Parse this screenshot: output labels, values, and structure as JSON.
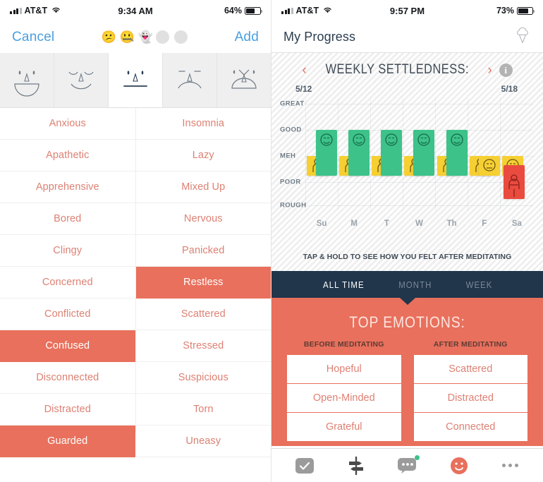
{
  "left": {
    "status": {
      "carrier": "AT&T",
      "time": "9:34 AM",
      "battery": "64%"
    },
    "nav": {
      "cancel": "Cancel",
      "add": "Add"
    },
    "progress_dots": [
      "😕",
      "🤐",
      "👻",
      "",
      ""
    ],
    "faces": [
      {
        "name": "big-smile",
        "selected": false
      },
      {
        "name": "closed-eye-smile",
        "selected": false
      },
      {
        "name": "neutral",
        "selected": true
      },
      {
        "name": "frown",
        "selected": false
      },
      {
        "name": "distressed",
        "selected": false
      }
    ],
    "emotions_left": [
      {
        "label": "Anxious",
        "selected": false
      },
      {
        "label": "Apathetic",
        "selected": false
      },
      {
        "label": "Apprehensive",
        "selected": false
      },
      {
        "label": "Bored",
        "selected": false
      },
      {
        "label": "Clingy",
        "selected": false
      },
      {
        "label": "Concerned",
        "selected": false
      },
      {
        "label": "Conflicted",
        "selected": false
      },
      {
        "label": "Confused",
        "selected": true
      },
      {
        "label": "Disconnected",
        "selected": false
      },
      {
        "label": "Distracted",
        "selected": false
      },
      {
        "label": "Guarded",
        "selected": true
      }
    ],
    "emotions_right": [
      {
        "label": "Insomnia",
        "selected": false
      },
      {
        "label": "Lazy",
        "selected": false
      },
      {
        "label": "Mixed Up",
        "selected": false
      },
      {
        "label": "Nervous",
        "selected": false
      },
      {
        "label": "Panicked",
        "selected": false
      },
      {
        "label": "Restless",
        "selected": true
      },
      {
        "label": "Scattered",
        "selected": false
      },
      {
        "label": "Stressed",
        "selected": false
      },
      {
        "label": "Suspicious",
        "selected": false
      },
      {
        "label": "Torn",
        "selected": false
      },
      {
        "label": "Uneasy",
        "selected": false
      }
    ]
  },
  "right": {
    "status": {
      "carrier": "AT&T",
      "time": "9:57 PM",
      "battery": "73%"
    },
    "nav": {
      "title": "My Progress",
      "action_icon": "ice-cream-cone-icon"
    },
    "chart_header": {
      "prev": "‹",
      "title": "WEEKLY SETTLEDNESS:",
      "next": "›",
      "info": "i"
    },
    "date_range": {
      "start": "5/12",
      "end": "5/18"
    },
    "hint": "TAP & HOLD TO SEE HOW YOU FELT AFTER MEDITATING",
    "tabs": [
      {
        "label": "ALL TIME",
        "active": true
      },
      {
        "label": "MONTH",
        "active": false
      },
      {
        "label": "WEEK",
        "active": false
      }
    ],
    "top_emotions": {
      "title": "TOP EMOTIONS:",
      "before_header": "BEFORE MEDITATING",
      "after_header": "AFTER MEDITATING",
      "before": [
        "Hopeful",
        "Open-Minded",
        "Grateful"
      ],
      "after": [
        "Scattered",
        "Distracted",
        "Connected"
      ]
    },
    "bottom_nav": [
      {
        "name": "checkmark-icon"
      },
      {
        "name": "signpost-icon"
      },
      {
        "name": "chat-bubble-icon",
        "badge": true
      },
      {
        "name": "smiley-face-icon",
        "active": true
      },
      {
        "name": "more-icon"
      }
    ]
  },
  "chart_data": {
    "type": "bar",
    "title": "WEEKLY SETTLEDNESS:",
    "xlabel": "",
    "ylabel": "",
    "categories": [
      "Su",
      "M",
      "T",
      "W",
      "Th",
      "F",
      "Sa"
    ],
    "ylevels": [
      "GREAT",
      "GOOD",
      "MEH",
      "POOR",
      "ROUGH"
    ],
    "ylim": [
      0,
      5
    ],
    "grid": true,
    "legend_position": "none",
    "date_start": "5/12",
    "date_end": "5/18",
    "series": [
      {
        "name": "Before Meditating",
        "values": [
          "MEH",
          "MEH",
          "MEH",
          "MEH",
          "MEH",
          "MEH",
          "MEH"
        ],
        "numeric": [
          3,
          3,
          3,
          3,
          3,
          3,
          3
        ],
        "color": "#f6cf33"
      },
      {
        "name": "After Meditating",
        "values": [
          "GOOD",
          "GOOD",
          "GOOD",
          "GOOD",
          "GOOD",
          "MEH",
          "POOR"
        ],
        "numeric": [
          4,
          4,
          4,
          4,
          4,
          3,
          2
        ],
        "colors": [
          "#3dc28a",
          "#3dc28a",
          "#3dc28a",
          "#3dc28a",
          "#3dc28a",
          "#f6cf33",
          "#ea4b3f"
        ]
      }
    ],
    "annotation": "TAP & HOLD TO SEE HOW YOU FELT AFTER MEDITATING"
  }
}
